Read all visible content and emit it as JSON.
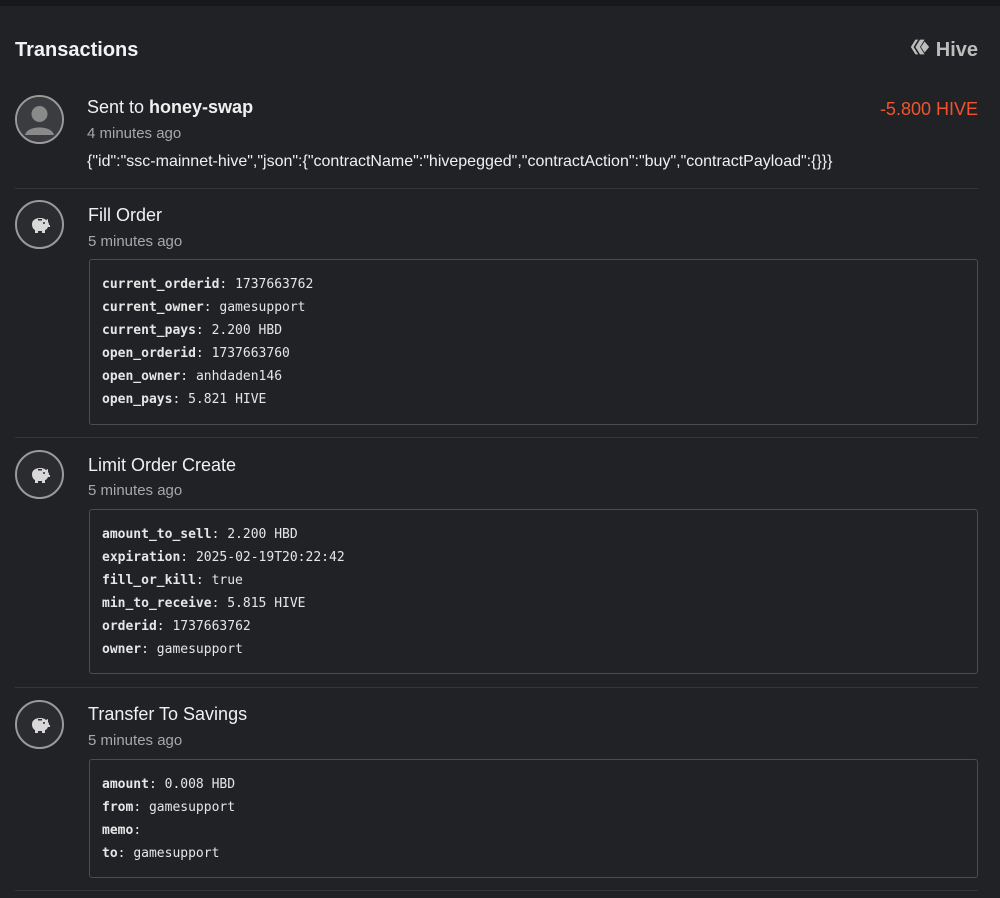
{
  "header": {
    "title": "Transactions",
    "brand_label": "Hive"
  },
  "transactions": [
    {
      "icon": "user-avatar-icon",
      "title_prefix": "Sent to ",
      "title_strong": "honey-swap",
      "time": "4 minutes ago",
      "amount": "-5.800 HIVE",
      "amount_color": "#f0542e",
      "memo": "{\"id\":\"ssc-mainnet-hive\",\"json\":{\"contractName\":\"hivepegged\",\"contractAction\":\"buy\",\"contractPayload\":{}}}"
    },
    {
      "icon": "piggy-bank-icon",
      "title": "Fill Order",
      "time": "5 minutes ago",
      "fields": [
        {
          "key": "current_orderid",
          "value": "1737663762"
        },
        {
          "key": "current_owner",
          "value": "gamesupport"
        },
        {
          "key": "current_pays",
          "value": "2.200 HBD"
        },
        {
          "key": "open_orderid",
          "value": "1737663760"
        },
        {
          "key": "open_owner",
          "value": "anhdaden146"
        },
        {
          "key": "open_pays",
          "value": "5.821 HIVE"
        }
      ]
    },
    {
      "icon": "piggy-bank-icon",
      "title": "Limit Order Create",
      "time": "5 minutes ago",
      "fields": [
        {
          "key": "amount_to_sell",
          "value": "2.200 HBD"
        },
        {
          "key": "expiration",
          "value": "2025-02-19T20:22:42"
        },
        {
          "key": "fill_or_kill",
          "value": "true"
        },
        {
          "key": "min_to_receive",
          "value": "5.815 HIVE"
        },
        {
          "key": "orderid",
          "value": "1737663762"
        },
        {
          "key": "owner",
          "value": "gamesupport"
        }
      ]
    },
    {
      "icon": "piggy-bank-icon",
      "title": "Transfer To Savings",
      "time": "5 minutes ago",
      "fields": [
        {
          "key": "amount",
          "value": "0.008 HBD"
        },
        {
          "key": "from",
          "value": "gamesupport"
        },
        {
          "key": "memo",
          "value": ""
        },
        {
          "key": "to",
          "value": "gamesupport"
        }
      ]
    }
  ]
}
